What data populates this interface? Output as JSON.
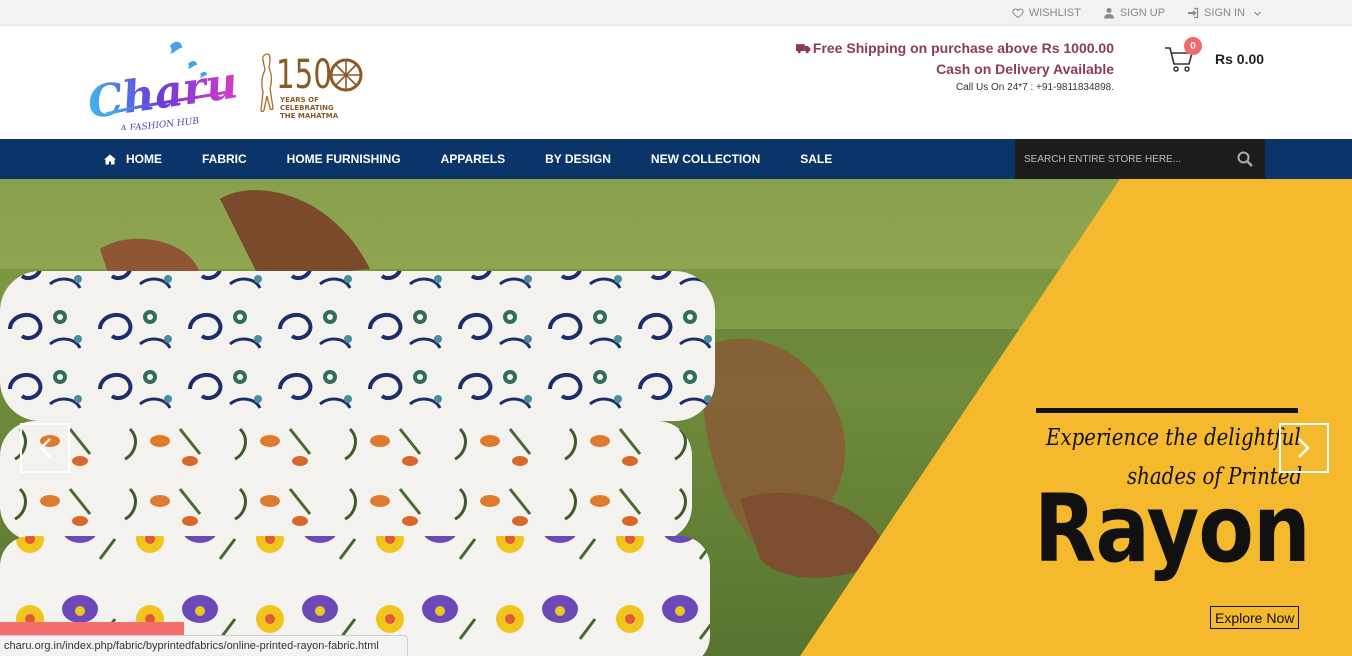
{
  "topbar": {
    "wishlist": "WISHLIST",
    "signup": "SIGN UP",
    "signin": "SIGN IN"
  },
  "header": {
    "logo_text": "Charu",
    "logo_tagline": "A FASHION HUB",
    "anniv_number": "150",
    "anniv_line1": "YEARS OF",
    "anniv_line2": "CELEBRATING",
    "anniv_line3": "THE MAHATMA",
    "shipping_line": "Free Shipping on purchase above Rs 1000.00",
    "cod_line": "Cash on Delivery Available",
    "call_line": "Call Us On 24*7 : +91-9811834898.",
    "cart_count": "0",
    "cart_total": "Rs 0.00"
  },
  "nav": {
    "items": [
      {
        "label": "HOME"
      },
      {
        "label": "FABRIC"
      },
      {
        "label": "HOME FURNISHING"
      },
      {
        "label": "APPARELS"
      },
      {
        "label": "BY DESIGN"
      },
      {
        "label": "NEW COLLECTION"
      },
      {
        "label": "SALE"
      }
    ],
    "search_placeholder": "SEARCH ENTIRE STORE HERE..."
  },
  "banner": {
    "line1": "Experience the delightful",
    "line2": "shades of Printed",
    "headline": "Rayon",
    "cta": "Explore Now"
  },
  "status_url": "charu.org.in/index.php/fabric/byprintedfabrics/online-printed-rayon-fabric.html",
  "colors": {
    "nav_bg": "#0b3469",
    "accent_yellow": "#f4b92c",
    "shipping_text": "#8b3a5a",
    "badge": "#f46a6a"
  }
}
